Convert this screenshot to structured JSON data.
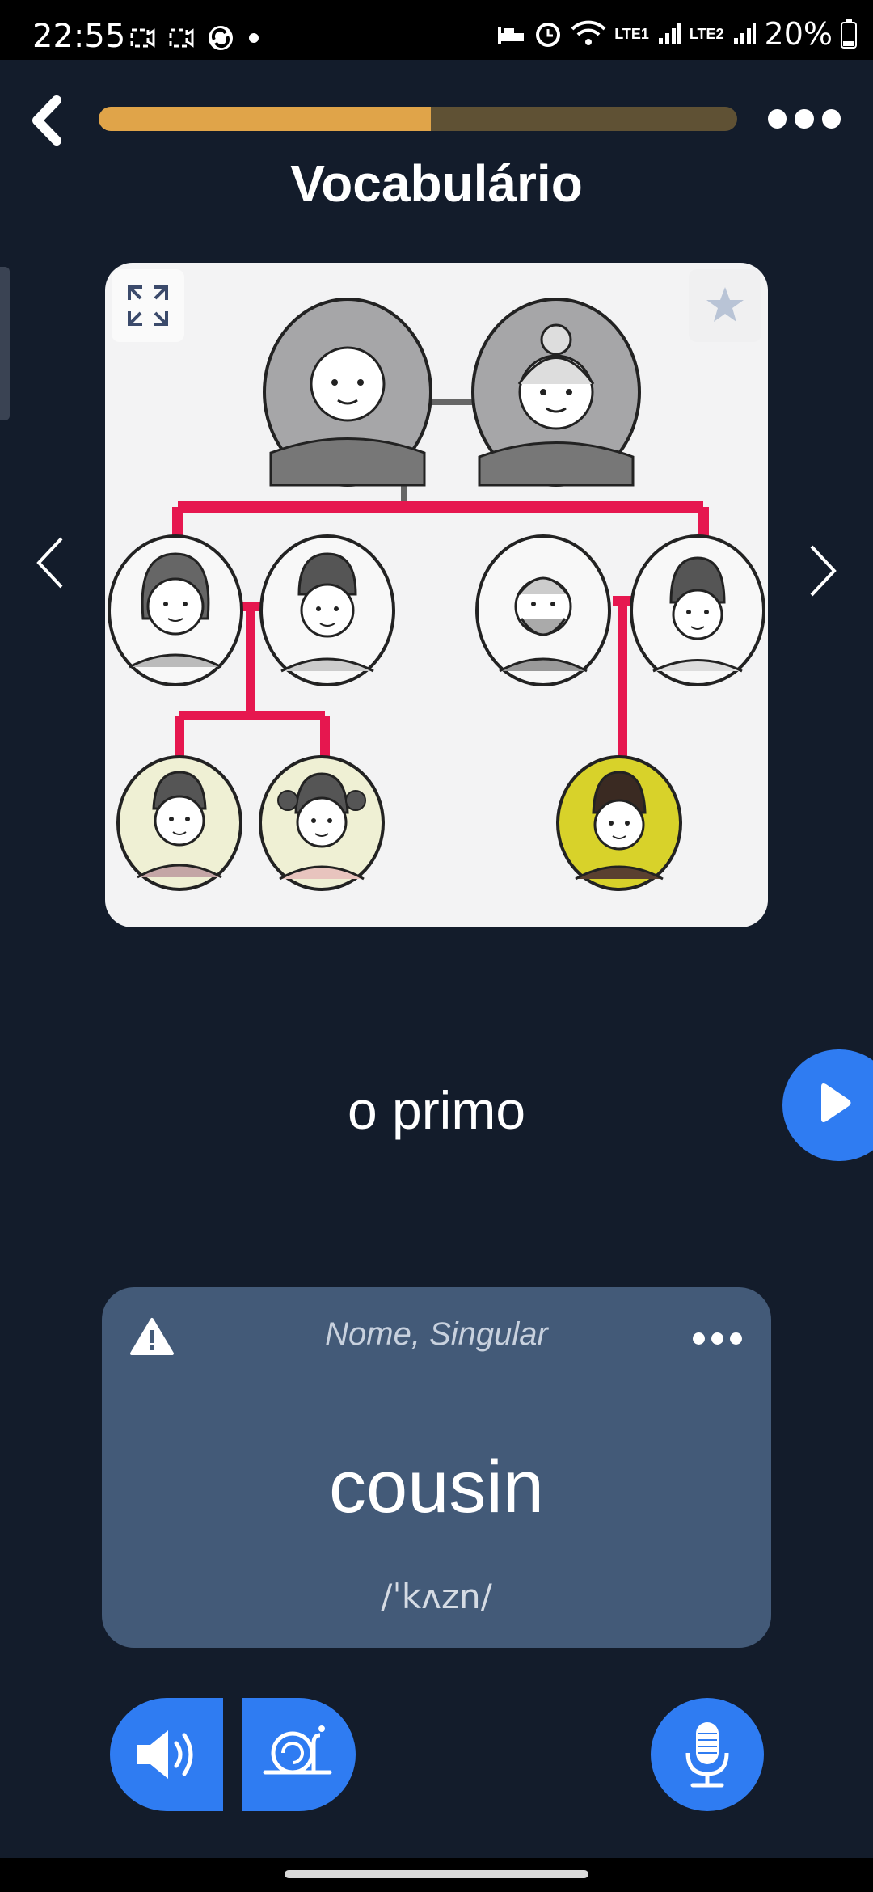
{
  "status_bar": {
    "time": "22:55",
    "battery": "20%",
    "network1": "LTE1",
    "network2": "LTE2",
    "icons": [
      "screenshot-icon",
      "screen-record-icon",
      "sync-icon",
      "dot-icon",
      "sleep-icon",
      "alarm-icon",
      "wifi-icon",
      "signal-icon",
      "battery-icon"
    ]
  },
  "header": {
    "title": "Vocabulário",
    "progress": 0.52,
    "colors": {
      "progress_fill": "#e0a449",
      "progress_track": "#5f5134"
    }
  },
  "flashcard": {
    "image_alt": "family-tree-illustration",
    "word": "o primo"
  },
  "translation_card": {
    "word_type": "Nome, Singular",
    "translation": "cousin",
    "phonetic": "/ˈkʌzn/"
  },
  "colors": {
    "background": "#131c2b",
    "accent": "#2f7cf2",
    "card": "#435a78",
    "tree_line": "#e6174f",
    "highlight": "#d8d22a"
  }
}
